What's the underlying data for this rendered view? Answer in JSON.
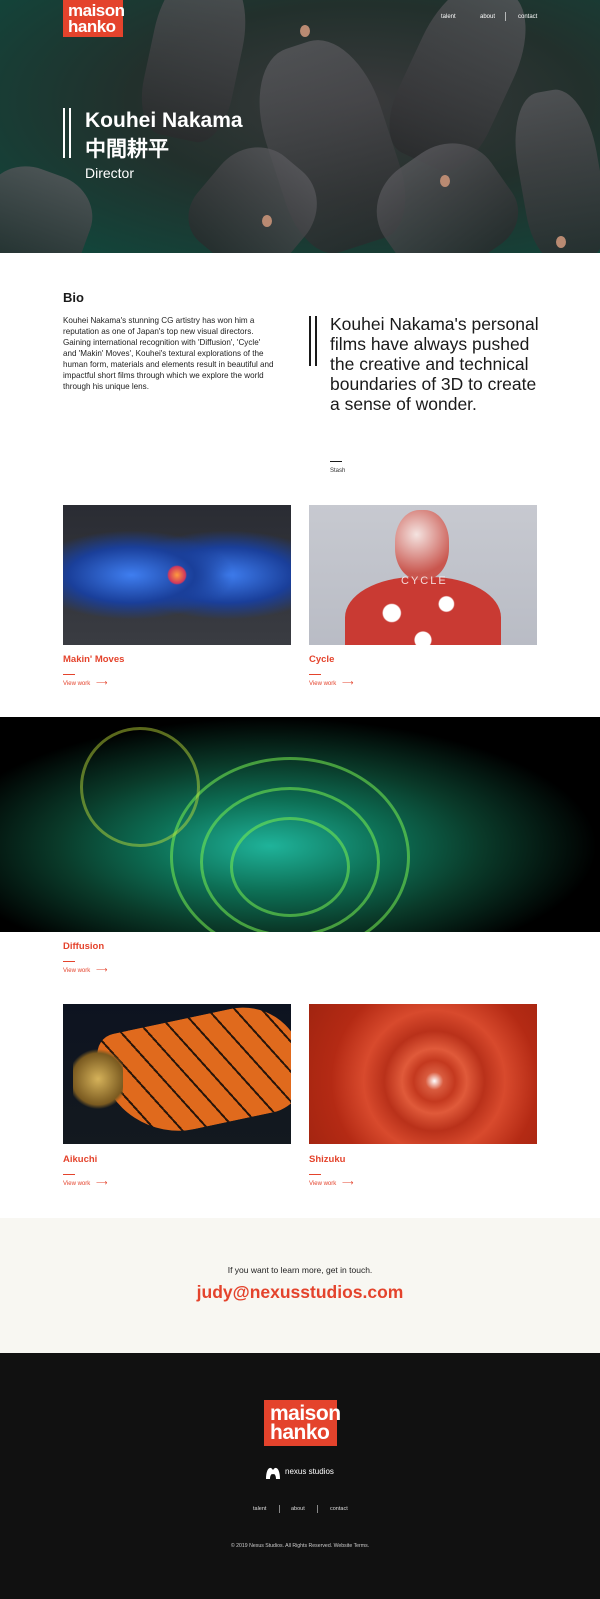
{
  "brand": {
    "logo_line1": "maison",
    "logo_line2": "hanko",
    "accent": "#e4432c"
  },
  "nav": {
    "items": [
      "talent",
      "about",
      "contact"
    ]
  },
  "hero": {
    "name": "Kouhei Nakama",
    "name_jp": "中間耕平",
    "role": "Director"
  },
  "bio": {
    "title": "Bio",
    "text": "Kouhei Nakama's stunning CG artistry has won him a reputation as one of Japan's top new visual directors. Gaining international recognition with 'Diffusion', 'Cycle' and 'Makin' Moves', Kouhei's textural explorations of the human form, materials and elements result in beautiful and impactful short films through which we explore the world through his unique lens."
  },
  "quote": {
    "text": "Kouhei Nakama's personal films have always pushed the creative and technical boundaries of 3D to create a sense of wonder.",
    "source": "Stash"
  },
  "works": [
    {
      "title": "Makin' Moves",
      "link": "View work"
    },
    {
      "title": "Cycle",
      "link": "View work",
      "image_text": "CYCLE"
    },
    {
      "title": "Diffusion",
      "link": "View work"
    },
    {
      "title": "Aikuchi",
      "link": "View work"
    },
    {
      "title": "Shizuku",
      "link": "View work"
    }
  ],
  "cta": {
    "text": "If you want to learn more, get in touch.",
    "email": "judy@nexusstudios.com"
  },
  "footer": {
    "nexus_label": "nexus studios",
    "nav": [
      "talent",
      "about",
      "contact"
    ],
    "copyright": "© 2019 Nexus Studios. All Rights Reserved. Website Terms."
  }
}
